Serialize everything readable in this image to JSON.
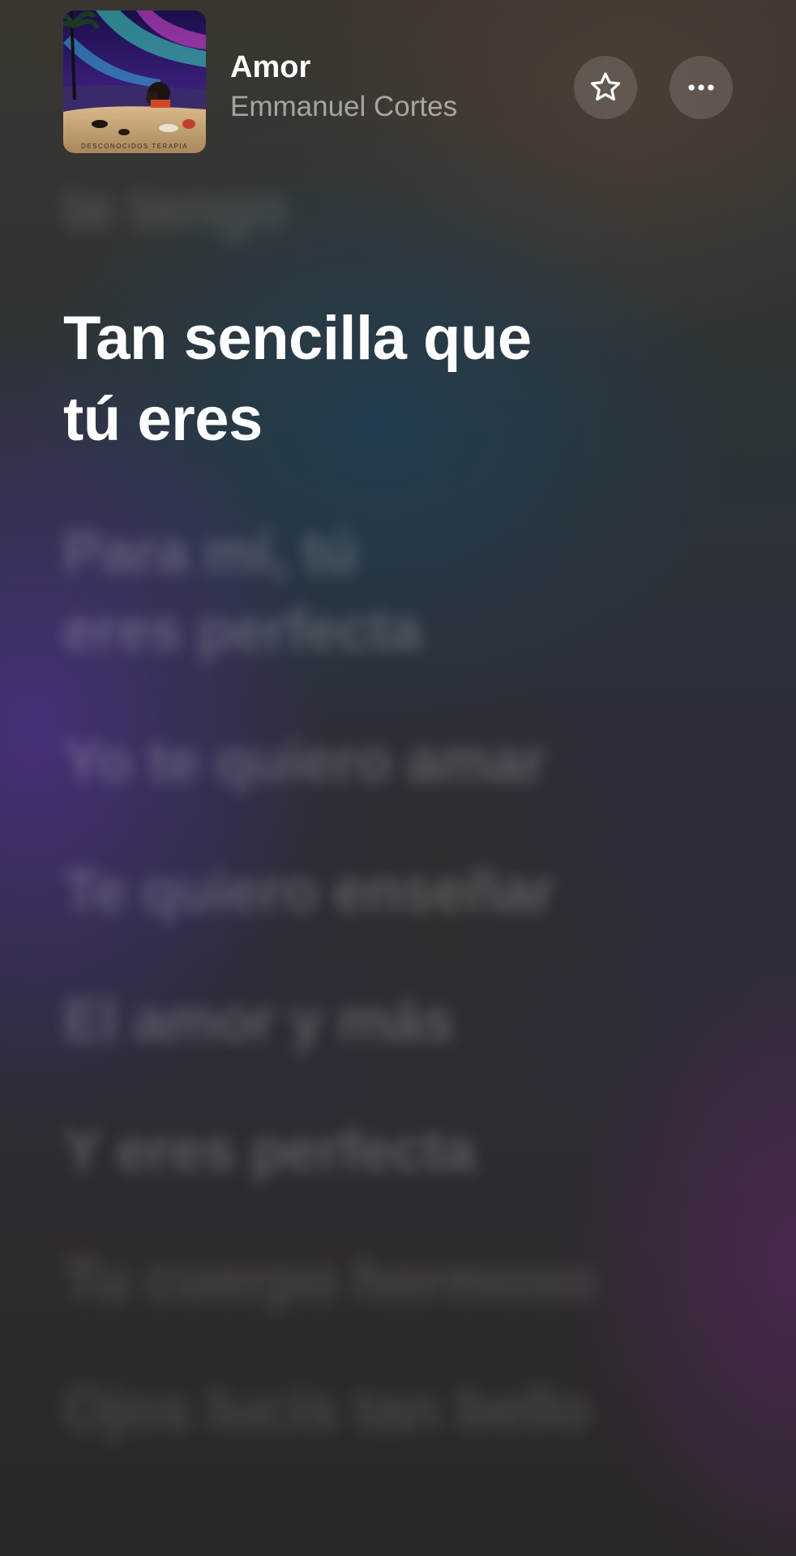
{
  "now_playing": {
    "title": "Amor",
    "artist": "Emmanuel Cortes",
    "artwork_text": "DESCONOCIDOS TERAPIA"
  },
  "controls": {
    "favorite_icon": "star-outline-icon",
    "more_icon": "ellipsis-icon"
  },
  "lyrics": {
    "lines": [
      "te tengo",
      "Tan sencilla que\ntú eres",
      "Para mí, tú\neres perfecta",
      "Yo te quiero amar",
      "Te quiero enseñar",
      "El amor y más",
      "Y eres perfecta",
      "Tu cuerpo hermoso",
      "Ojos lucís tan bello"
    ],
    "active_index": 1
  },
  "colors": {
    "active_lyric": "#ffffff",
    "inactive_lyric": "rgba(255,255,255,0.22)",
    "artist_text": "rgba(255,255,255,0.55)",
    "button_bg": "rgba(255,255,255,0.14)"
  }
}
